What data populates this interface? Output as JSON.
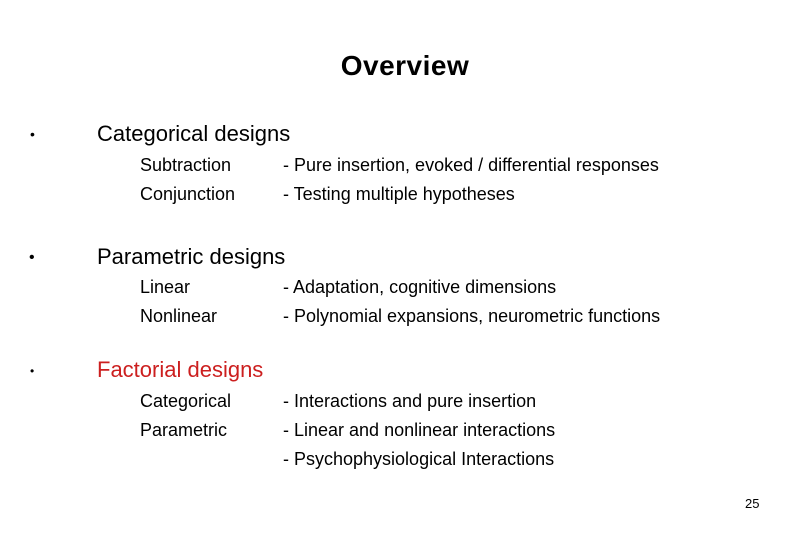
{
  "slide": {
    "title": "Overview",
    "page_number": "25",
    "accent_color": "#cc1f1f",
    "sections": [
      {
        "bullet": "•",
        "heading": "Categorical designs",
        "rows": [
          {
            "label": "Subtraction",
            "description": "- Pure insertion, evoked / differential responses"
          },
          {
            "label": "Conjunction",
            "description": "- Testing multiple hypotheses"
          }
        ]
      },
      {
        "bullet": "•",
        "heading": "Parametric designs",
        "rows": [
          {
            "label": "Linear",
            "description": "- Adaptation, cognitive dimensions"
          },
          {
            "label": "Nonlinear",
            "description": "- Polynomial expansions, neurometric functions"
          }
        ]
      },
      {
        "bullet": "•",
        "heading": "Factorial designs",
        "rows": [
          {
            "label": "Categorical",
            "description": "- Interactions and pure insertion"
          },
          {
            "label": "Parametric",
            "description": "- Linear and nonlinear interactions"
          },
          {
            "label": "",
            "description": "- Psychophysiological Interactions"
          }
        ]
      }
    ]
  }
}
